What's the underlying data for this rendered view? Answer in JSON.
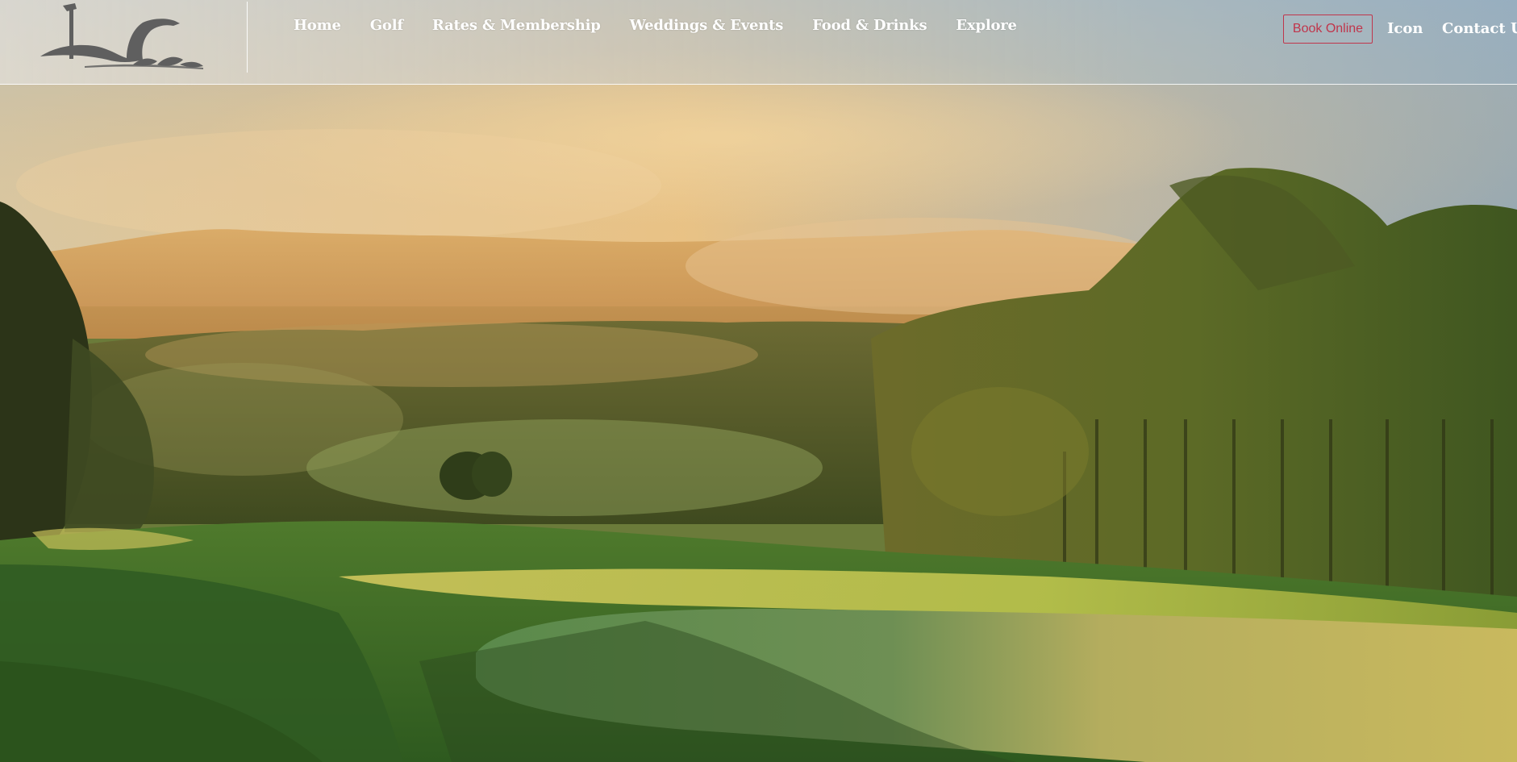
{
  "nav": {
    "items": [
      {
        "label": "Home"
      },
      {
        "label": "Golf"
      },
      {
        "label": "Rates & Membership"
      },
      {
        "label": "Weddings & Events"
      },
      {
        "label": "Food & Drinks"
      },
      {
        "label": "Explore"
      }
    ]
  },
  "header": {
    "book_label": "Book Online",
    "icon_label": "Icon",
    "contact_label": "Contact Us"
  },
  "colors": {
    "accent": "#c0354b",
    "nav_text": "#ffffff",
    "logo": "#5f5f5f"
  },
  "icons": {
    "logo": "sea-serpent-logo-icon"
  }
}
